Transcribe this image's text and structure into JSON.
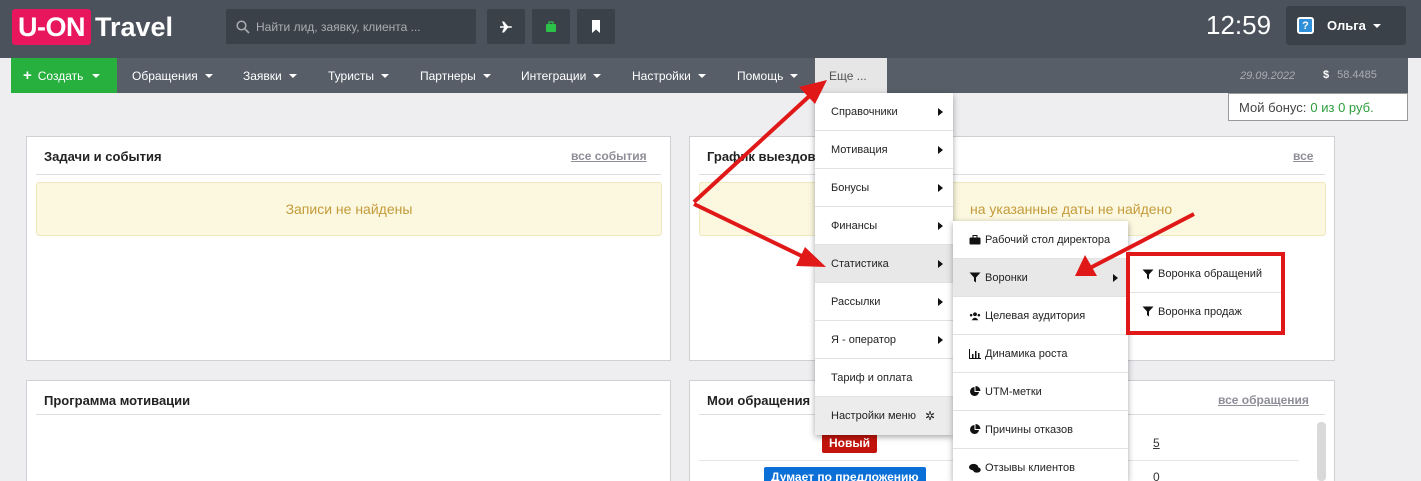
{
  "brand": {
    "logo_box": "U-ON",
    "logo_text": "Travel"
  },
  "search": {
    "placeholder": "Найти лид, заявку, клиента ..."
  },
  "toolbar": {
    "plane_icon": "plane-icon",
    "bag_icon": "briefcase-icon",
    "bookmark_icon": "bookmark-icon"
  },
  "clock": "12:59",
  "user": {
    "name": "Ольга"
  },
  "nav": {
    "create": "Создать",
    "items": [
      "Обращения",
      "Заявки",
      "Туристы",
      "Партнеры",
      "Интеграции",
      "Настройки",
      "Помощь"
    ],
    "more": "Еще ...",
    "date": "29.09.2022",
    "currency": "$",
    "amount": "58.4485"
  },
  "bonus": {
    "label": "Мой бонус:",
    "value": "0 из 0 руб."
  },
  "panels": {
    "tasks": {
      "title": "Задачи и события",
      "link": "все события",
      "empty": "Записи не найдены"
    },
    "trips": {
      "title": "График выездов",
      "link": "все",
      "empty": "Ничего не найдено на указанные даты не найдено",
      "empty_visible": "на указанные даты не найдено"
    },
    "motivation": {
      "title": "Программа мотивации"
    },
    "requests": {
      "title": "Мои обращения",
      "link": "все обращения",
      "rows": [
        {
          "status": "Новый",
          "count": "5",
          "color": "#c3140c"
        },
        {
          "status": "Думает по предложению",
          "count": "0",
          "color": "#0a6fd6"
        }
      ]
    }
  },
  "more_menu": {
    "items": [
      "Справочники",
      "Мотивация",
      "Бонусы",
      "Финансы",
      "Статистика",
      "Рассылки",
      "Я - оператор",
      "Тариф и оплата"
    ],
    "settings": "Настройки меню"
  },
  "stats_menu": {
    "items": [
      {
        "label": "Рабочий стол директора",
        "icon": "briefcase-icon"
      },
      {
        "label": "Воронки",
        "icon": "filter-icon"
      },
      {
        "label": "Целевая аудитория",
        "icon": "users-icon"
      },
      {
        "label": "Динамика роста",
        "icon": "chart-icon"
      },
      {
        "label": "UTM-метки",
        "icon": "pie-icon"
      },
      {
        "label": "Причины отказов",
        "icon": "pie-icon"
      },
      {
        "label": "Отзывы клиентов",
        "icon": "comments-icon"
      }
    ]
  },
  "funnels_menu": {
    "items": [
      {
        "label": "Воронка обращений",
        "icon": "filter-icon"
      },
      {
        "label": "Воронка продаж",
        "icon": "filter-icon"
      }
    ]
  },
  "colors": {
    "topbar": "#4b525c",
    "nav": "#575e68",
    "create": "#27b03e",
    "logo": "#e8175d",
    "annotation": "#e01818"
  }
}
